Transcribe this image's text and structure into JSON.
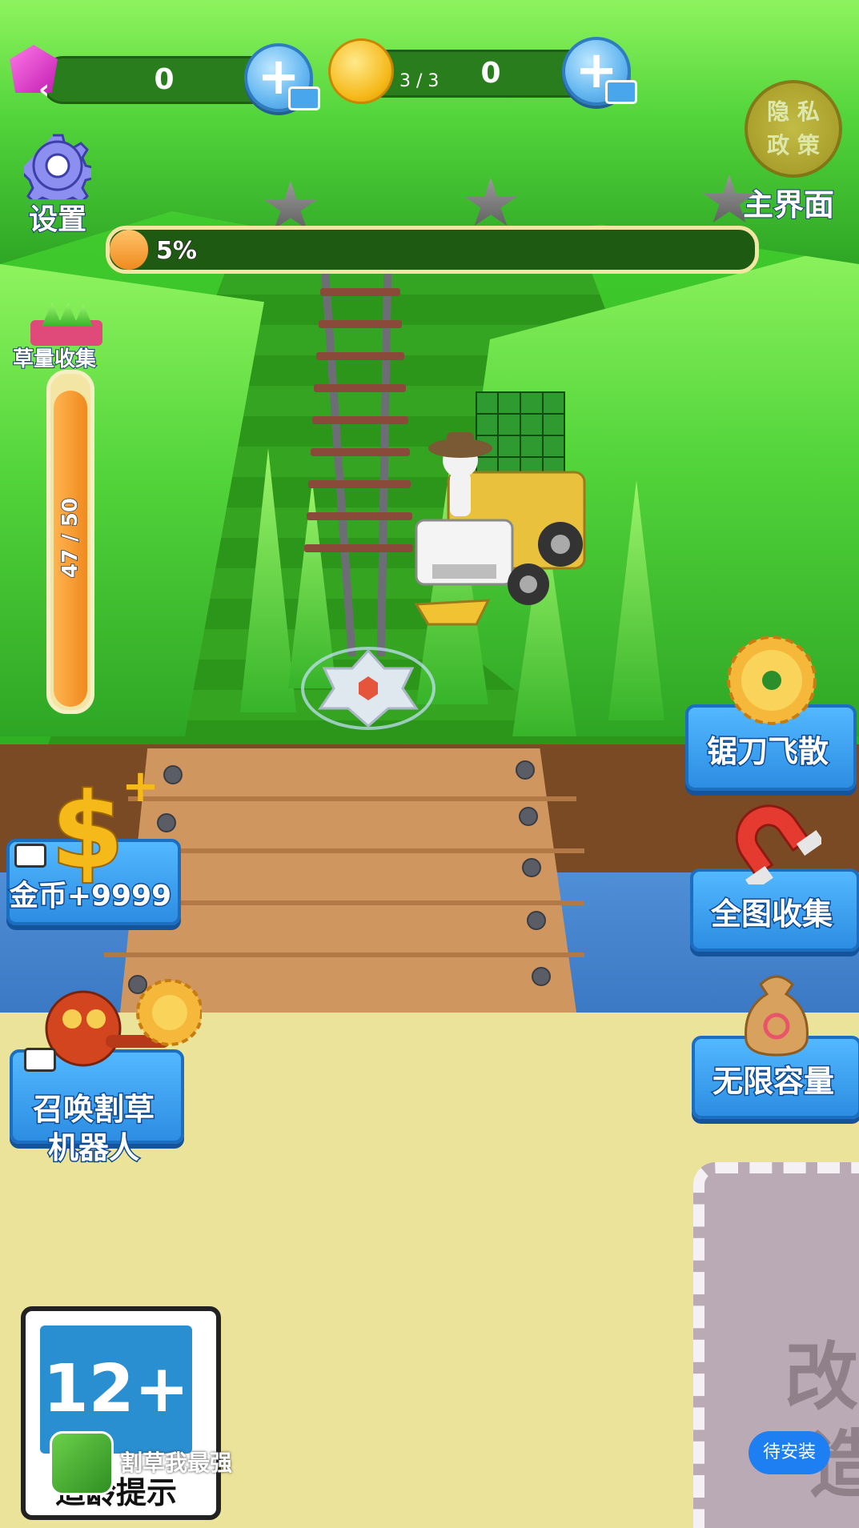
{
  "hud": {
    "gems": "0",
    "coins": "0",
    "coin_counter": "3 / 3",
    "settings_label": "设置",
    "privacy_label_1": "隐 私",
    "privacy_label_2": "政 策",
    "home_label": "主界面",
    "progress_text": "5%",
    "progress_value": 0.05,
    "grass_label": "草量收集",
    "grass_counter": "47 / 50",
    "grass_value": 0.94
  },
  "buttons": {
    "saw_scatter": "锯刀飞散",
    "map_collect": "全图收集",
    "unlimited_capacity": "无限容量",
    "coins_bonus": "金币+9999",
    "summon_robot_line1": "召唤割草",
    "summon_robot_line2": "机器人"
  },
  "lot": {
    "char1": "改",
    "char2": "造"
  },
  "footer": {
    "age_rating": "12+",
    "age_tip": "适龄提示",
    "app_name": "割草我最强",
    "install_label": "待安装"
  },
  "icons": [
    "gem-icon",
    "coin-icon",
    "plus-video-icon",
    "gear-icon",
    "star-icon",
    "saw-blade-icon",
    "magnet-icon",
    "money-bag-icon",
    "dollar-icon",
    "robot-icon",
    "back-arrow-icon"
  ]
}
